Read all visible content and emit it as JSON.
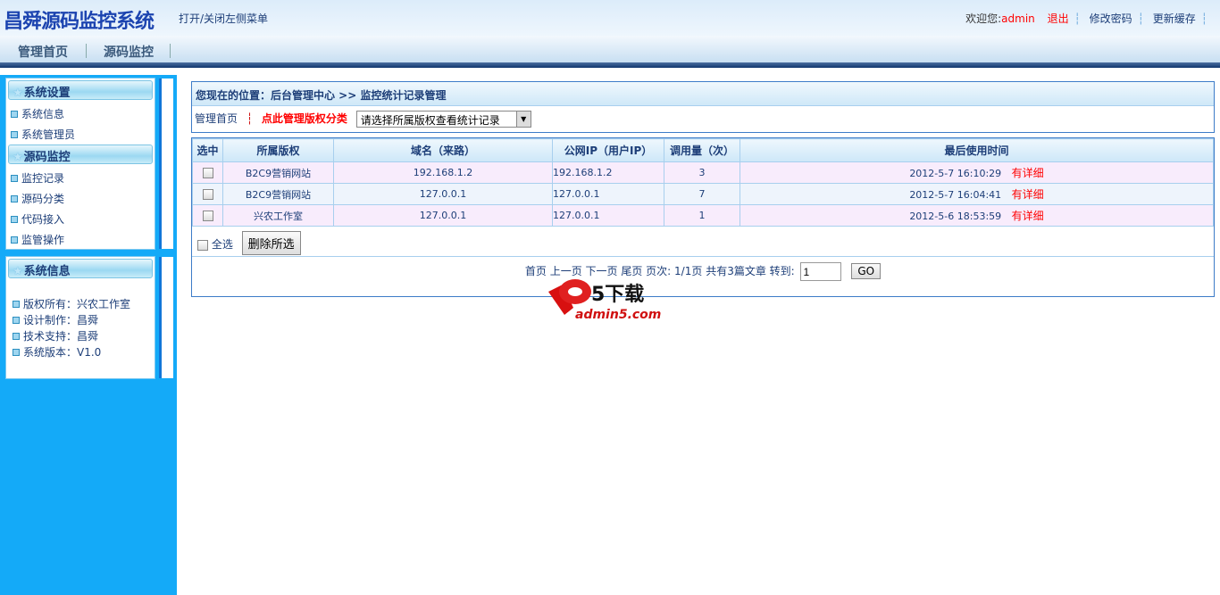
{
  "header": {
    "logo": "昌舜源码监控系统",
    "toggle_menu": "打开/关闭左侧菜单",
    "welcome": "欢迎您:",
    "username": "admin",
    "logout": "退出",
    "change_password": "修改密码",
    "update_cache": "更新缓存"
  },
  "nav": {
    "items": [
      "管理首页",
      "源码监控"
    ]
  },
  "sidebar": {
    "section1": {
      "title": "系统设置",
      "items": [
        "系统信息",
        "系统管理员"
      ]
    },
    "section2": {
      "title": "源码监控",
      "items": [
        "监控记录",
        "源码分类",
        "代码接入",
        "监管操作"
      ]
    },
    "info": {
      "title": "系统信息",
      "lines": [
        "版权所有：兴农工作室",
        "设计制作：昌舜",
        "技术支持：昌舜",
        "系统版本：V1.0"
      ]
    }
  },
  "breadcrumb": "您现在的位置：后台管理中心 >> 监控统计记录管理",
  "filter": {
    "home": "管理首页",
    "manage_categories": "点此管理版权分类",
    "select_value": "请选择所属版权查看统计记录"
  },
  "table": {
    "headers": [
      "选中",
      "所属版权",
      "域名（来路）",
      "公网IP（用户IP）",
      "调用量（次）",
      "最后使用时间"
    ],
    "rows": [
      {
        "owner": "B2C9营销网站",
        "domain": "192.168.1.2",
        "ip": "192.168.1.2",
        "count": "3",
        "time": "2012-5-7 16:10:29",
        "detail": "有详细"
      },
      {
        "owner": "B2C9营销网站",
        "domain": "127.0.0.1",
        "ip": "127.0.0.1",
        "count": "7",
        "time": "2012-5-7 16:04:41",
        "detail": "有详细"
      },
      {
        "owner": "兴农工作室",
        "domain": "127.0.0.1",
        "ip": "127.0.0.1",
        "count": "1",
        "time": "2012-5-6 18:53:59",
        "detail": "有详细"
      }
    ],
    "select_all": "全选",
    "delete_selected": "删除所选"
  },
  "pagination": {
    "links": "首页 上一页 下一页 尾页 页次:",
    "page": "1/1页",
    "total": "共有3篇文章",
    "goto": "转到:",
    "goto_value": "1",
    "go": "GO"
  },
  "watermark": {
    "text": "a5下载",
    "url": "admin5.com"
  }
}
